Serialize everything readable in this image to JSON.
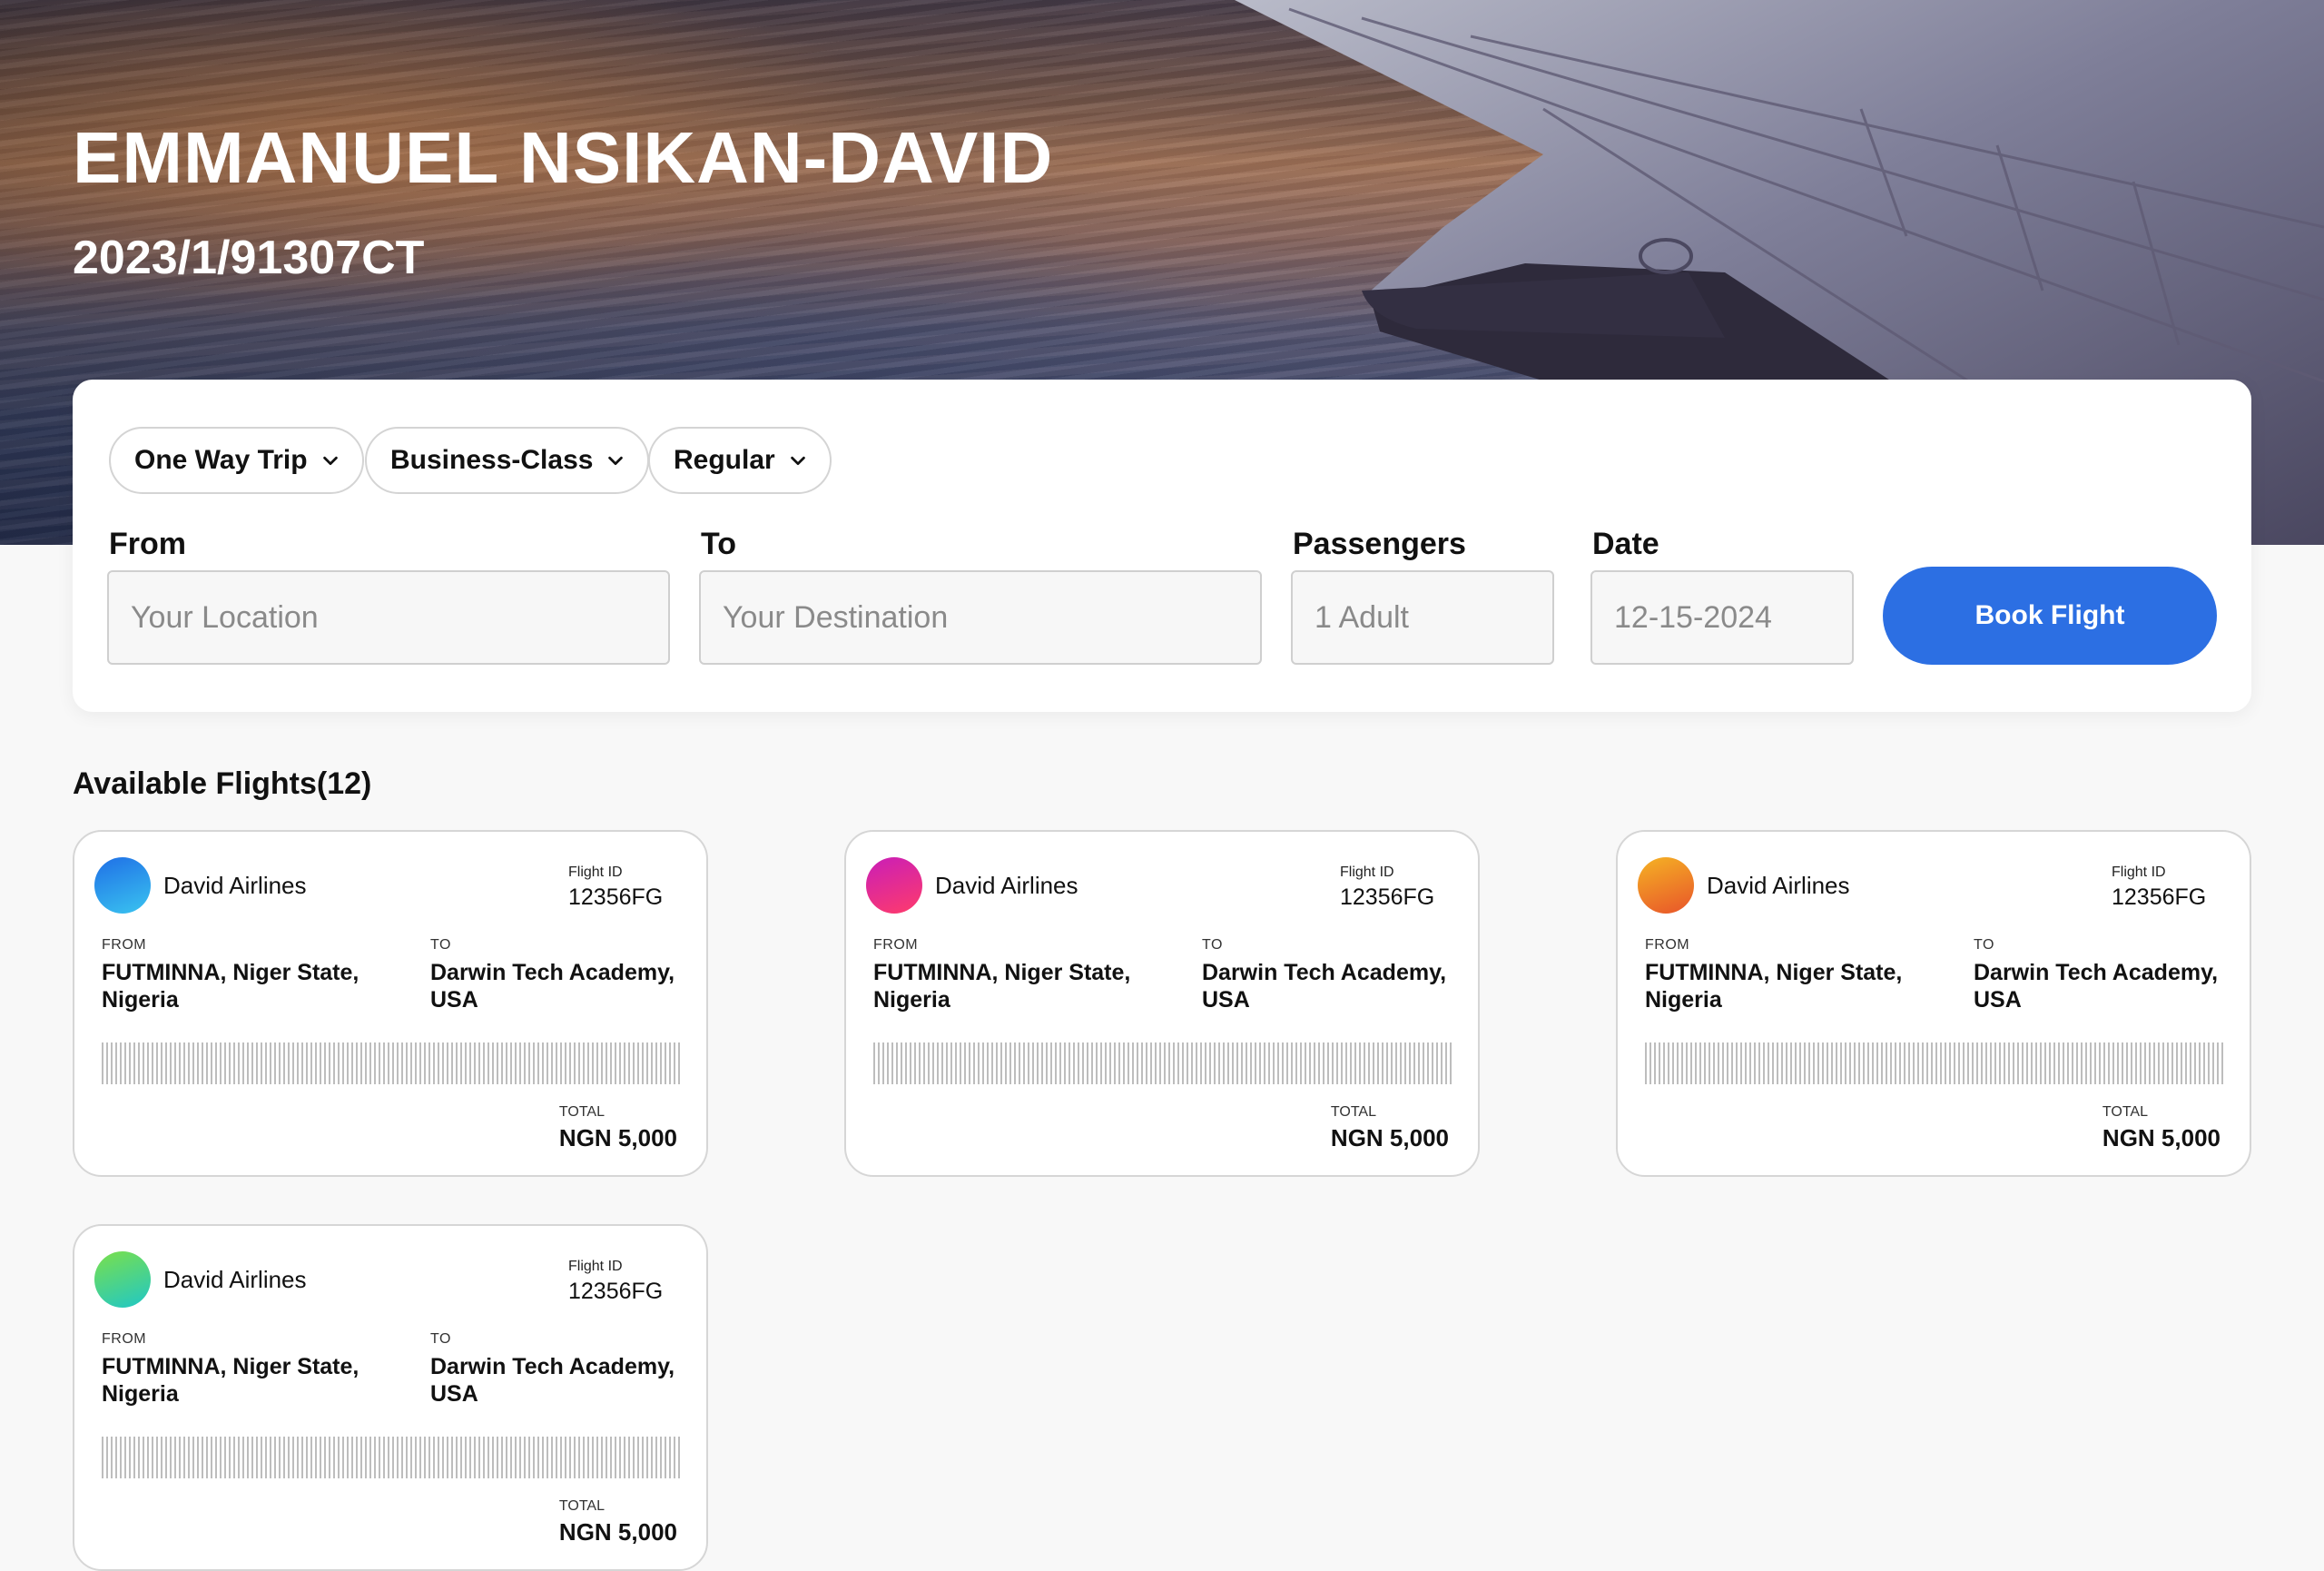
{
  "header": {
    "name": "EMMANUEL NSIKAN-DAVID",
    "id_code": "2023/1/91307CT"
  },
  "filters": {
    "trip_type": "One Way Trip",
    "cabin_class": "Business-Class",
    "fare_type": "Regular"
  },
  "search": {
    "from_label": "From",
    "from_placeholder": "Your Location",
    "to_label": "To",
    "to_placeholder": "Your Destination",
    "passengers_label": "Passengers",
    "passengers_placeholder": "1 Adult",
    "date_label": "Date",
    "date_placeholder": "12-15-2024",
    "book_button": "Book Flight"
  },
  "flights_title": "Available Flights(12)",
  "flights": [
    {
      "airline": "David Airlines",
      "flight_id_label": "Flight ID",
      "flight_id": "12356FG",
      "from_label": "FROM",
      "from": "FUTMINNA, Niger State, Nigeria",
      "to_label": "TO",
      "to": "Darwin Tech Academy, USA",
      "total_label": "TOTAL",
      "total": "NGN 5,000",
      "logo_colors": [
        "#1f6fe6",
        "#3ac4f0"
      ]
    },
    {
      "airline": "David Airlines",
      "flight_id_label": "Flight ID",
      "flight_id": "12356FG",
      "from_label": "FROM",
      "from": "FUTMINNA, Niger State, Nigeria",
      "to_label": "TO",
      "to": "Darwin Tech Academy, USA",
      "total_label": "TOTAL",
      "total": "NGN 5,000",
      "logo_colors": [
        "#c91eb8",
        "#ff3b6b"
      ]
    },
    {
      "airline": "David Airlines",
      "flight_id_label": "Flight ID",
      "flight_id": "12356FG",
      "from_label": "FROM",
      "from": "FUTMINNA, Niger State, Nigeria",
      "to_label": "TO",
      "to": "Darwin Tech Academy, USA",
      "total_label": "TOTAL",
      "total": "NGN 5,000",
      "logo_colors": [
        "#f5b324",
        "#e8542a"
      ]
    },
    {
      "airline": "David Airlines",
      "flight_id_label": "Flight ID",
      "flight_id": "12356FG",
      "from_label": "FROM",
      "from": "FUTMINNA, Niger State, Nigeria",
      "to_label": "TO",
      "to": "Darwin Tech Academy, USA",
      "total_label": "TOTAL",
      "total": "NGN 5,000",
      "logo_colors": [
        "#7be04a",
        "#1fc7c7"
      ]
    }
  ],
  "colors": {
    "accent": "#2c6fe3",
    "page_background": "#f8f8f8"
  }
}
